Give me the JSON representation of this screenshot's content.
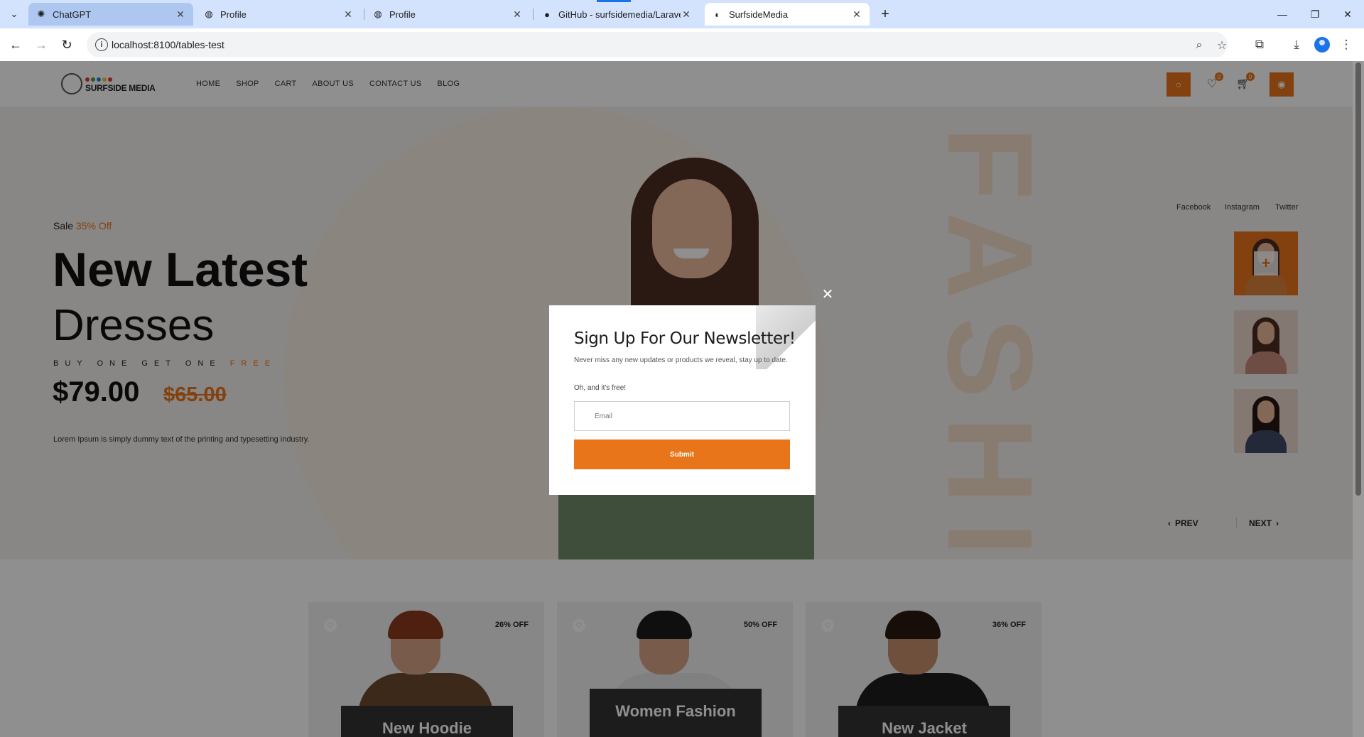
{
  "browser": {
    "tabs": [
      {
        "label": "ChatGPT"
      },
      {
        "label": "Profile"
      },
      {
        "label": "Profile"
      },
      {
        "label": "GitHub - surfsidemedia/Laravel"
      },
      {
        "label": "SurfsideMedia"
      }
    ],
    "url": "localhost:8100/tables-test"
  },
  "site": {
    "logo_text": "SURFSIDE MEDIA",
    "logo_colors": [
      "#e53935",
      "#43a047",
      "#1e88e5",
      "#fbc02d",
      "#e53935"
    ],
    "nav": [
      "HOME",
      "SHOP",
      "CART",
      "ABOUT US",
      "CONTACT US",
      "BLOG"
    ],
    "wishlist_count": "0",
    "cart_count": "0",
    "accent_color": "#e8751a"
  },
  "hero": {
    "sale_label": "Sale",
    "sale_pct": "35% Off",
    "title_line1": "New Latest",
    "title_line2": "Dresses",
    "bogo_text": "BUY ONE GET ONE",
    "bogo_free": "FREE",
    "price": "$79.00",
    "old_price": "$65.00",
    "description": "Lorem Ipsum is simply dummy text of the printing and typesetting industry.",
    "watermark": "FASHI",
    "social": [
      "Facebook",
      "Instagram",
      "Twitter"
    ],
    "prev_label": "PREV",
    "next_label": "NEXT"
  },
  "products": [
    {
      "discount": "26% OFF",
      "label": "New Hoodie"
    },
    {
      "discount": "50% OFF",
      "label": "Women Fashion"
    },
    {
      "discount": "36% OFF",
      "label": "New Jacket"
    }
  ],
  "newsletter": {
    "title": "Sign Up For Our Newsletter!",
    "description": "Never miss any new updates or products we reveal, stay up to date.",
    "free_note": "Oh, and it's free!",
    "email_placeholder": "Email",
    "submit_label": "Submit"
  }
}
